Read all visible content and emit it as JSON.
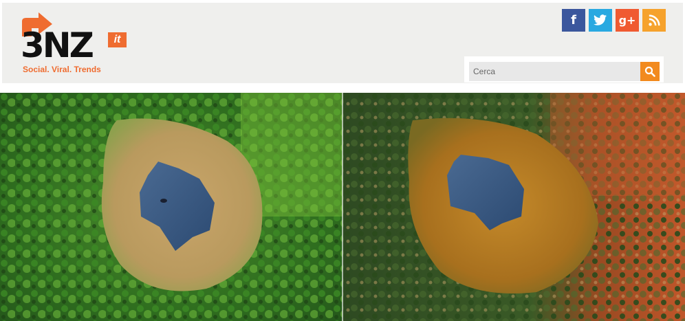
{
  "brand": {
    "logo_text": "3NZ",
    "logo_suffix": "it",
    "tagline": "Social. Viral. Trends",
    "accent_color": "#ef6c30"
  },
  "social": [
    {
      "name": "facebook",
      "glyph": "f",
      "color": "#3b579d"
    },
    {
      "name": "twitter",
      "glyph": "twitter-bird-icon",
      "color": "#29a9e1"
    },
    {
      "name": "google-plus",
      "glyph": "g+",
      "color": "#f05a31"
    },
    {
      "name": "rss",
      "glyph": "rss-icon",
      "color": "#f6a22c"
    }
  ],
  "search": {
    "placeholder": "Cerca",
    "button_icon": "search-icon",
    "button_color": "#f28a1e"
  },
  "hero": {
    "left_panel": "aerial-lake-summer",
    "right_panel": "aerial-lake-autumn"
  }
}
